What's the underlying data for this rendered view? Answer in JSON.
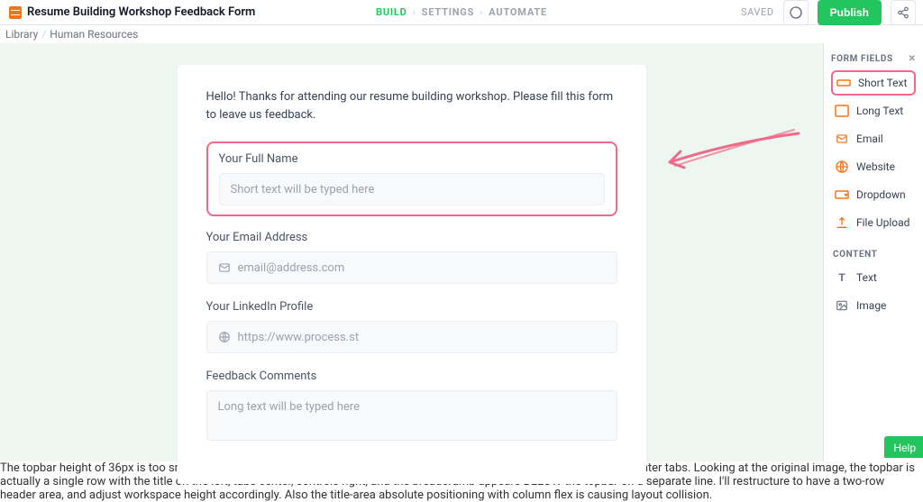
{
  "header": {
    "title": "Resume Building Workshop Feedback Form",
    "breadcrumb": {
      "library": "Library",
      "section": "Human Resources"
    },
    "tabs": {
      "build": "BUILD",
      "settings": "SETTINGS",
      "automate": "AUTOMATE"
    },
    "saved": "SAVED",
    "publish": "Publish"
  },
  "form": {
    "intro": "Hello! Thanks for attending our resume building workshop. Please fill this form to leave us feedback.",
    "fullname": {
      "label": "Your Full Name",
      "placeholder": "Short text will be typed here"
    },
    "email": {
      "label": "Your Email Address",
      "placeholder": "email@address.com"
    },
    "linkedin": {
      "label": "Your LinkedIn Profile",
      "placeholder": "https://www.process.st"
    },
    "feedback": {
      "label": "Feedback Comments",
      "placeholder": "Long text will be typed here"
    }
  },
  "sidebar": {
    "panel_title": "FORM FIELDS",
    "fields": {
      "short_text": "Short Text",
      "long_text": "Long Text",
      "email": "Email",
      "website": "Website",
      "dropdown": "Dropdown",
      "file_upload": "File Upload"
    },
    "content_title": "CONTENT",
    "content": {
      "text": "Text",
      "image": "Image"
    }
  },
  "help": "Help"
}
